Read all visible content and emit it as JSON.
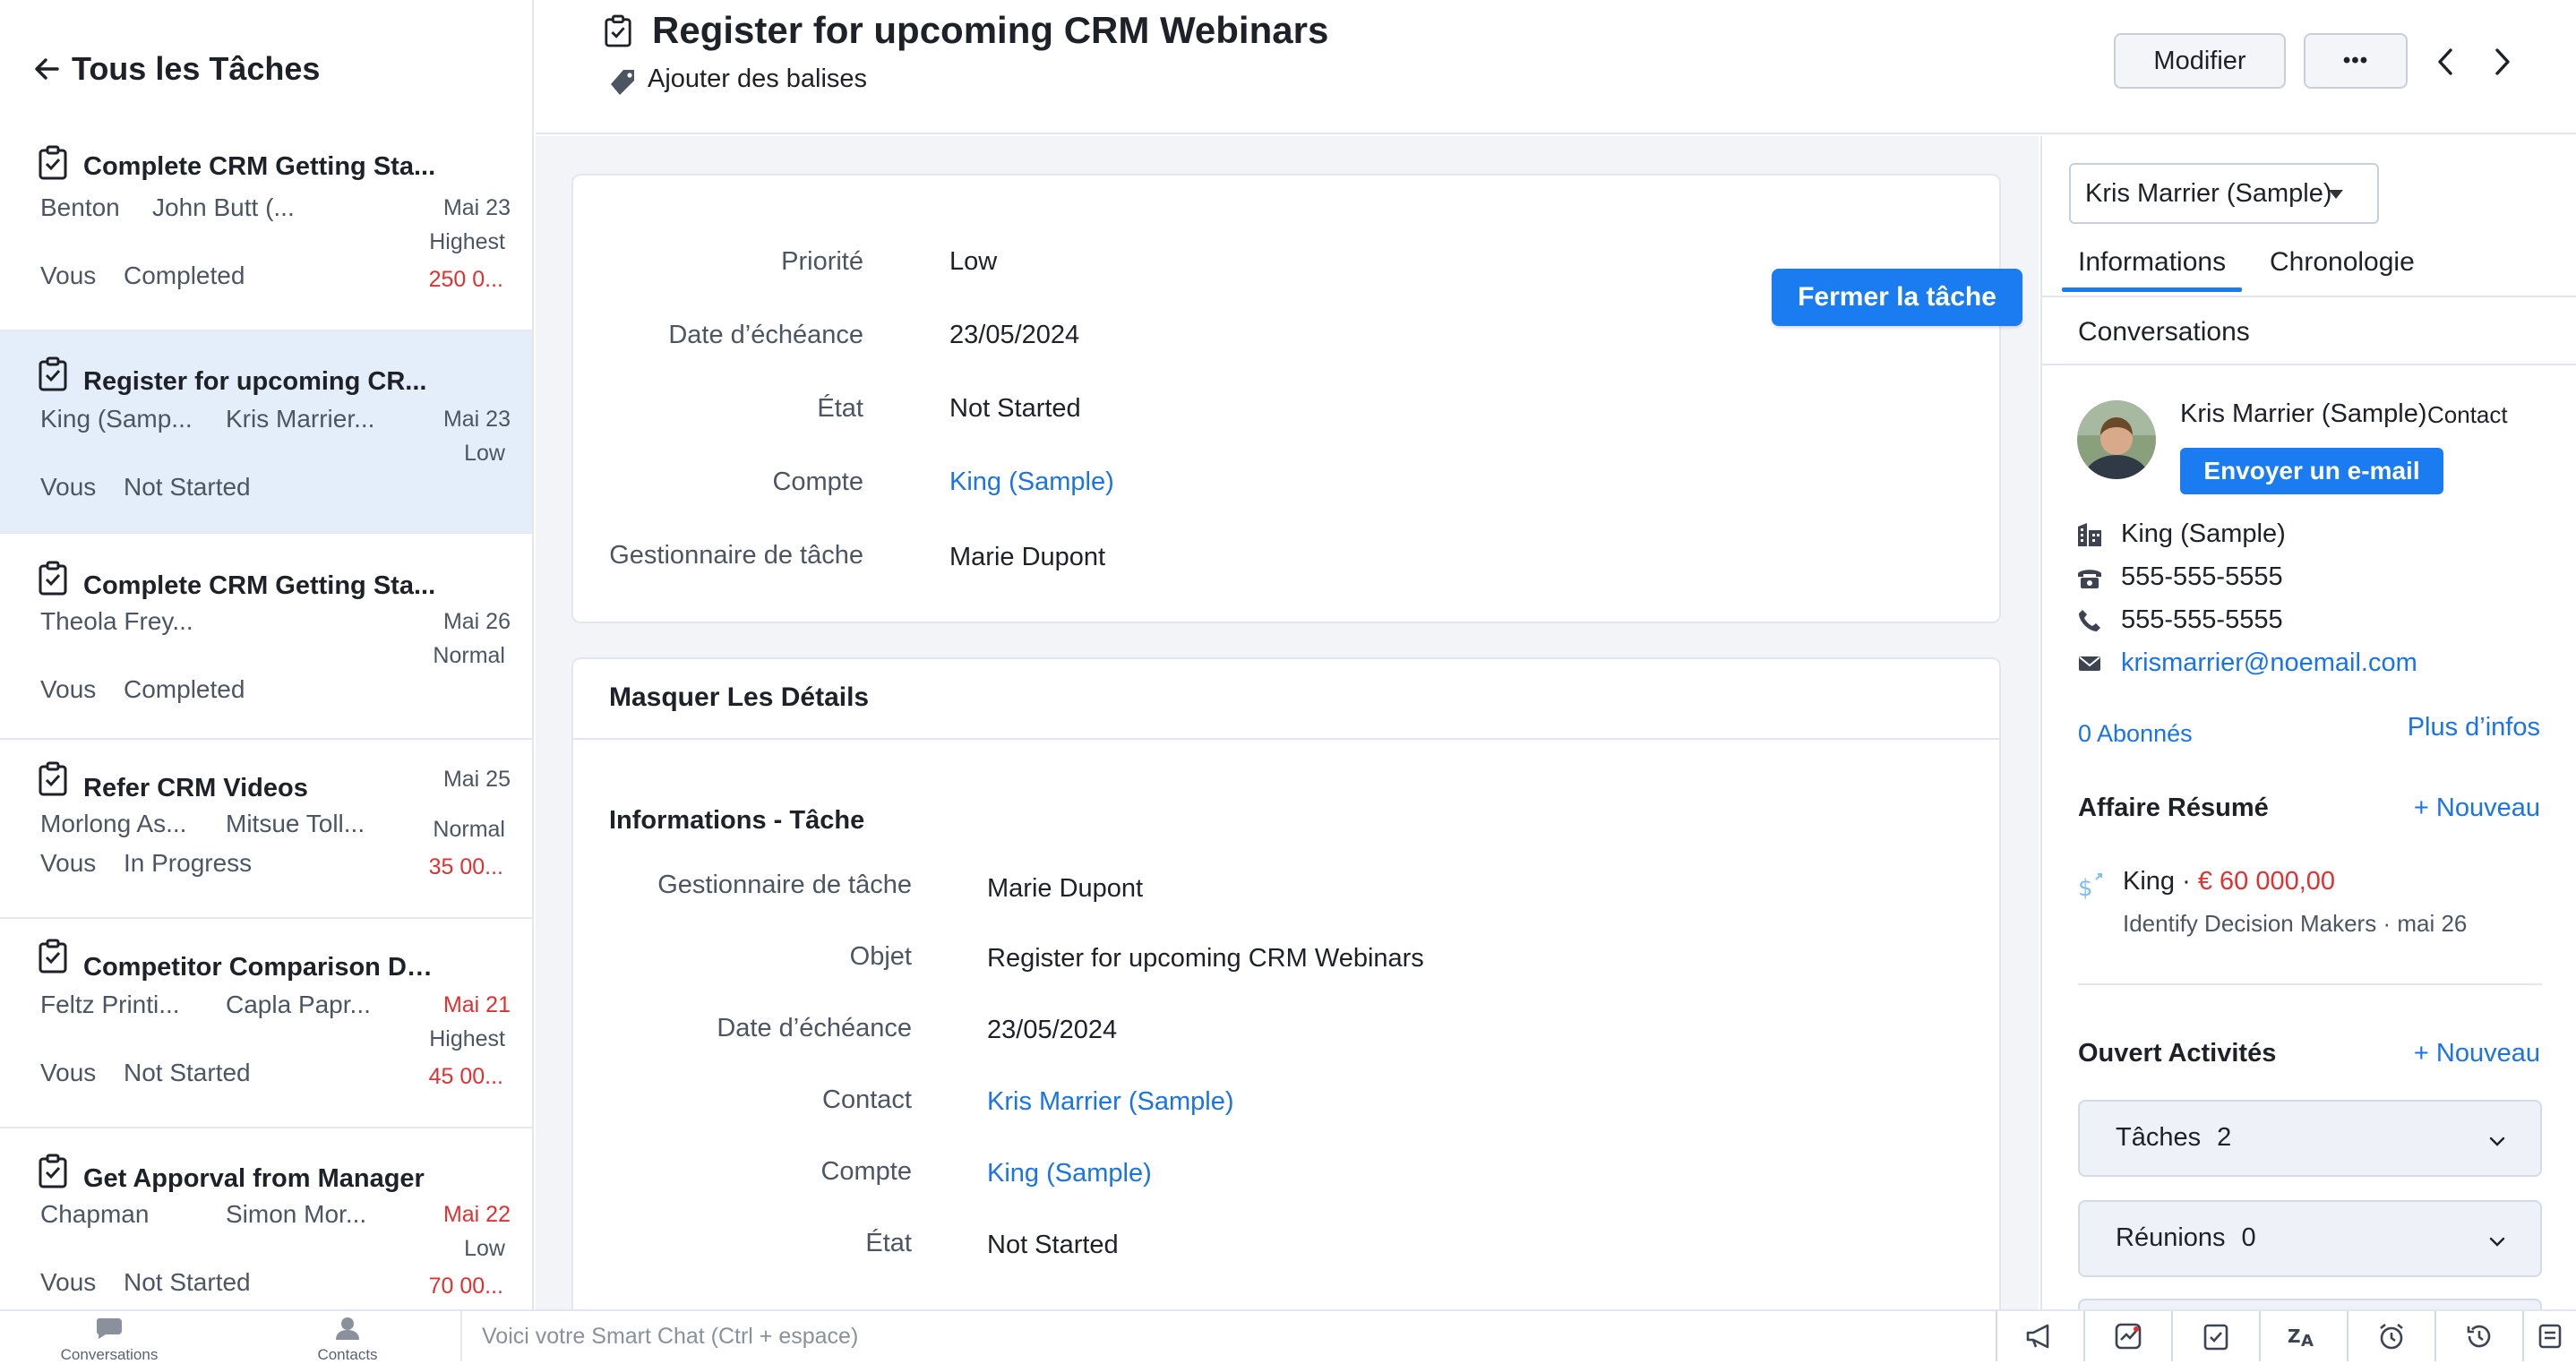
{
  "nav": {
    "back_label": "Tous les Tâches"
  },
  "task_list": [
    {
      "title": "Complete CRM Getting Sta...",
      "a": "Benton",
      "b": "John Butt (...",
      "date": "Mai 23",
      "priority": "Highest",
      "owner": "Vous",
      "status": "Completed",
      "amount": "250 0..."
    },
    {
      "title": "Register for upcoming CR...",
      "a": "King (Samp...",
      "b": "Kris Marrier...",
      "date": "Mai 23",
      "priority": "Low",
      "owner": "Vous",
      "status": "Not Started",
      "amount": ""
    },
    {
      "title": "Complete CRM Getting Sta...",
      "a": "Theola Frey...",
      "b": "",
      "date": "Mai 26",
      "priority": "Normal",
      "owner": "Vous",
      "status": "Completed",
      "amount": ""
    },
    {
      "title": "Refer CRM Videos",
      "a": "Morlong As...",
      "b": "Mitsue Toll...",
      "date": "Mai 25",
      "priority": "Normal",
      "owner": "Vous",
      "status": "In Progress",
      "amount": "35 00..."
    },
    {
      "title": "Competitor Comparison Do...",
      "a": "Feltz Printi...",
      "b": "Capla Papr...",
      "date": "Mai 21",
      "priority": "Highest",
      "owner": "Vous",
      "status": "Not Started",
      "amount": "45 00..."
    },
    {
      "title": "Get Apporval from Manager",
      "a": "Chapman",
      "b": "Simon Mor...",
      "date": "Mai 22",
      "priority": "Low",
      "owner": "Vous",
      "status": "Not Started",
      "amount": "70 00..."
    }
  ],
  "header": {
    "title": "Register for upcoming CRM Webinars",
    "tags_label": "Ajouter des balises",
    "edit_label": "Modifier",
    "more_label": "•••"
  },
  "summary": {
    "close_label": "Fermer la tâche",
    "fields": [
      {
        "label": "Priorité",
        "value": "Low"
      },
      {
        "label": "Date d’échéance",
        "value": "23/05/2024"
      },
      {
        "label": "État",
        "value": "Not Started"
      },
      {
        "label": "Compte",
        "value": "King (Sample)"
      },
      {
        "label": "Gestionnaire de tâche",
        "value": "Marie Dupont"
      }
    ]
  },
  "details": {
    "hide_label": "Masquer Les Détails",
    "section_title": "Informations - Tâche",
    "fields": [
      {
        "label": "Gestionnaire de tâche",
        "value": "Marie Dupont"
      },
      {
        "label": "Objet",
        "value": "Register for upcoming CRM Webinars"
      },
      {
        "label": "Date d’échéance",
        "value": "23/05/2024"
      },
      {
        "label": "Contact",
        "value": "Kris Marrier (Sample)"
      },
      {
        "label": "Compte",
        "value": "King (Sample)"
      },
      {
        "label": "État",
        "value": "Not Started"
      }
    ]
  },
  "right": {
    "contact_select": "Kris Marrier (Sample)",
    "tabs": [
      "Informations",
      "Chronologie",
      "Conversations"
    ],
    "contact_name": "Kris Marrier (Sample)",
    "contact_type": "Contact",
    "email_button": "Envoyer un e-mail",
    "account": "King (Sample)",
    "phone1": "555-555-5555",
    "phone2": "555-555-5555",
    "email": "krismarrier@noemail.com",
    "followers": "0 Abonnés",
    "more_info": "Plus d’infos",
    "deal_section": "Affaire Résumé",
    "new_label": "+ Nouveau",
    "deal_name": "King",
    "deal_sep": " · ",
    "deal_amount": "€ 60 000,00",
    "deal_stage": "Identify Decision Makers · mai 26",
    "activities_section": "Ouvert Activités",
    "tasks_label": "Tâches",
    "tasks_count": "2",
    "meetings_label": "Réunions",
    "meetings_count": "0"
  },
  "bottom": {
    "conversations": "Conversations",
    "contacts": "Contacts",
    "smartchat_placeholder": "Voici votre Smart Chat (Ctrl + espace)"
  },
  "colors": {
    "accent": "#1a7cf0",
    "link": "#1a73e8",
    "danger": "#e03131",
    "selected_row": "#e4eefb"
  }
}
